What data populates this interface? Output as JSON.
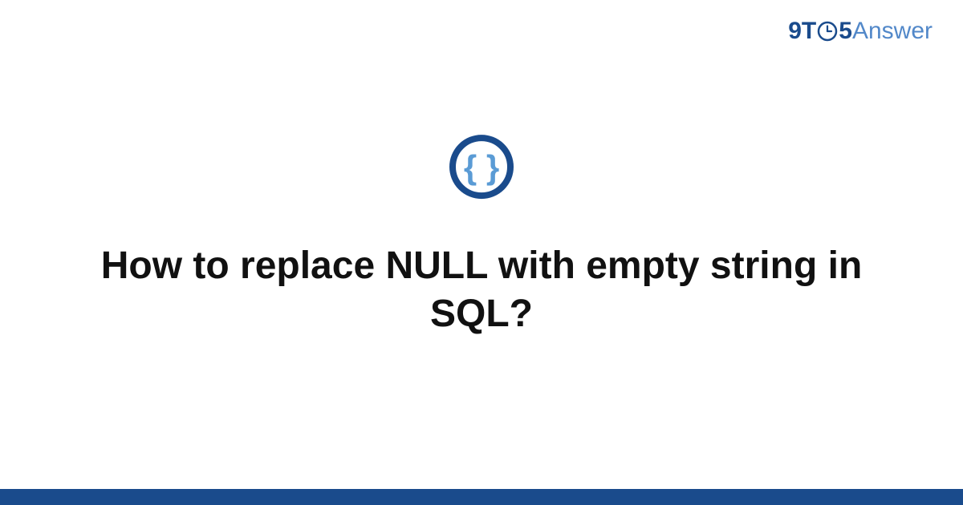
{
  "brand": {
    "prefix": "9T",
    "suffix": "5",
    "word": "Answer"
  },
  "question": {
    "title": "How to replace NULL with empty string in SQL?"
  },
  "colors": {
    "primary": "#1a4b8c",
    "secondary": "#5288c9",
    "iconRing": "#1a4b8c",
    "iconBraces": "#5a9bd5"
  }
}
